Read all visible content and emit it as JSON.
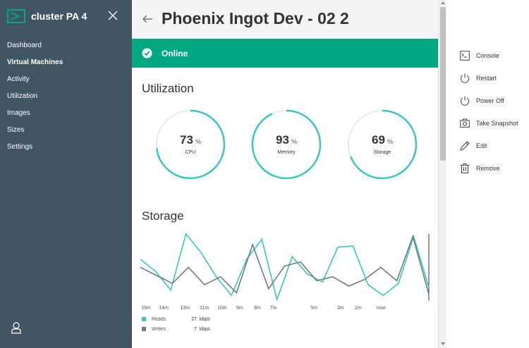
{
  "sidebar": {
    "title": "cluster PA 4",
    "nav": [
      {
        "label": "Dashboard"
      },
      {
        "label": "Virtual Machines"
      },
      {
        "label": "Activity"
      },
      {
        "label": "Utilization"
      },
      {
        "label": "Images"
      },
      {
        "label": "Sizes"
      },
      {
        "label": "Settings"
      }
    ],
    "active_index": 1
  },
  "header": {
    "title": "Phoenix Ingot Dev - 02 2"
  },
  "status": {
    "label": "Online"
  },
  "utilization": {
    "title": "Utilization",
    "meters": [
      {
        "value": "73",
        "unit": "%",
        "label": "CPU",
        "fraction": 0.73
      },
      {
        "value": "93",
        "unit": "%",
        "label": "Memory",
        "fraction": 0.93
      },
      {
        "value": "69",
        "unit": "%",
        "label": "Storage",
        "fraction": 0.69
      }
    ]
  },
  "storage": {
    "title": "Storage",
    "legend": [
      {
        "name": "Reads",
        "value": "27",
        "unit": "kbps"
      },
      {
        "name": "Writes",
        "value": "7",
        "unit": "kbps"
      }
    ]
  },
  "chart_data": {
    "type": "line",
    "x_ticks": [
      "16m",
      "14m",
      "13m",
      "11m",
      "10m",
      "9m",
      "8m",
      "7m",
      "5m",
      "3m",
      "2m",
      "now"
    ],
    "x_minutes_ago": [
      16,
      15,
      14,
      13,
      12,
      11,
      10,
      9,
      8,
      7,
      6,
      5,
      4,
      3,
      2,
      1,
      0.5,
      0
    ],
    "ylim": [
      0,
      100
    ],
    "series": [
      {
        "name": "Reads",
        "color": "#3bc5c0",
        "values": [
          62,
          44,
          16,
          100,
          72,
          36,
          8,
          62,
          92,
          2,
          66,
          40,
          28,
          80,
          82,
          24,
          8,
          26,
          96,
          20
        ]
      },
      {
        "name": "Writes",
        "color": "#6d7b87",
        "values": [
          50,
          38,
          26,
          50,
          24,
          36,
          12,
          84,
          18,
          52,
          58,
          30,
          36,
          22,
          32,
          50,
          30,
          96,
          10
        ]
      }
    ]
  },
  "actions": [
    {
      "label": "Console",
      "icon": "console-icon"
    },
    {
      "label": "Restart",
      "icon": "power-icon"
    },
    {
      "label": "Power Off",
      "icon": "power-icon"
    },
    {
      "label": "Take Snapshot",
      "icon": "camera-icon"
    },
    {
      "label": "Edit",
      "icon": "pencil-icon"
    },
    {
      "label": "Remove",
      "icon": "trash-icon"
    }
  ],
  "colors": {
    "sidebar": "#425563",
    "accent": "#01a982",
    "meter": "#3bc5c0",
    "meter_track": "#e8e8e8"
  }
}
